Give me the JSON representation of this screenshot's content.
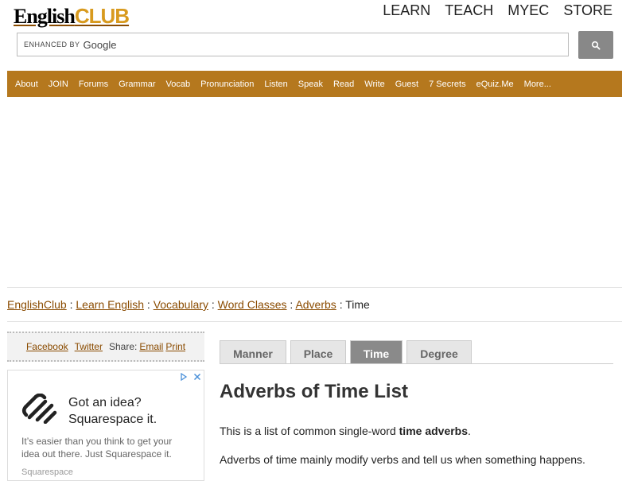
{
  "logo": {
    "part1": "English",
    "part2": "CLUB"
  },
  "topnav": [
    "LEARN",
    "TEACH",
    "MYEC",
    "STORE"
  ],
  "search": {
    "enhanced_label": "ENHANCED BY",
    "google_label": "Google",
    "value": ""
  },
  "mainnav": [
    "About",
    "JOIN",
    "Forums",
    "Grammar",
    "Vocab",
    "Pronunciation",
    "Listen",
    "Speak",
    "Read",
    "Write",
    "Guest",
    "7 Secrets",
    "eQuiz.Me",
    "More..."
  ],
  "breadcrumb": {
    "links": [
      "EnglishClub",
      "Learn English",
      "Vocabulary",
      "Word Classes",
      "Adverbs"
    ],
    "separator": ":",
    "current": "Time"
  },
  "share": {
    "facebook": "Facebook",
    "twitter": "Twitter",
    "share_label": "Share:",
    "email": "Email",
    "print": "Print"
  },
  "ad": {
    "headline_line1": "Got an idea?",
    "headline_line2": "Squarespace it.",
    "body_line1": "It’s easier than you think to get your",
    "body_line2": "idea out there. Just Squarespace it.",
    "brand": "Squarespace"
  },
  "tabs": [
    {
      "label": "Manner",
      "active": false
    },
    {
      "label": "Place",
      "active": false
    },
    {
      "label": "Time",
      "active": true
    },
    {
      "label": "Degree",
      "active": false
    }
  ],
  "content": {
    "title": "Adverbs of Time List",
    "intro_before": "This is a list of common single-word ",
    "intro_bold": "time adverbs",
    "intro_after": ".",
    "para2": "Adverbs of time mainly modify verbs and tell us when something happens."
  },
  "colors": {
    "nav_bg": "#b5781e",
    "link": "#8a4b00",
    "logo_accent": "#d89a1e",
    "active_tab": "#8a8a8a"
  },
  "icons": [
    "search-icon",
    "adchoices-icon",
    "close-icon",
    "squarespace-logo-icon"
  ]
}
